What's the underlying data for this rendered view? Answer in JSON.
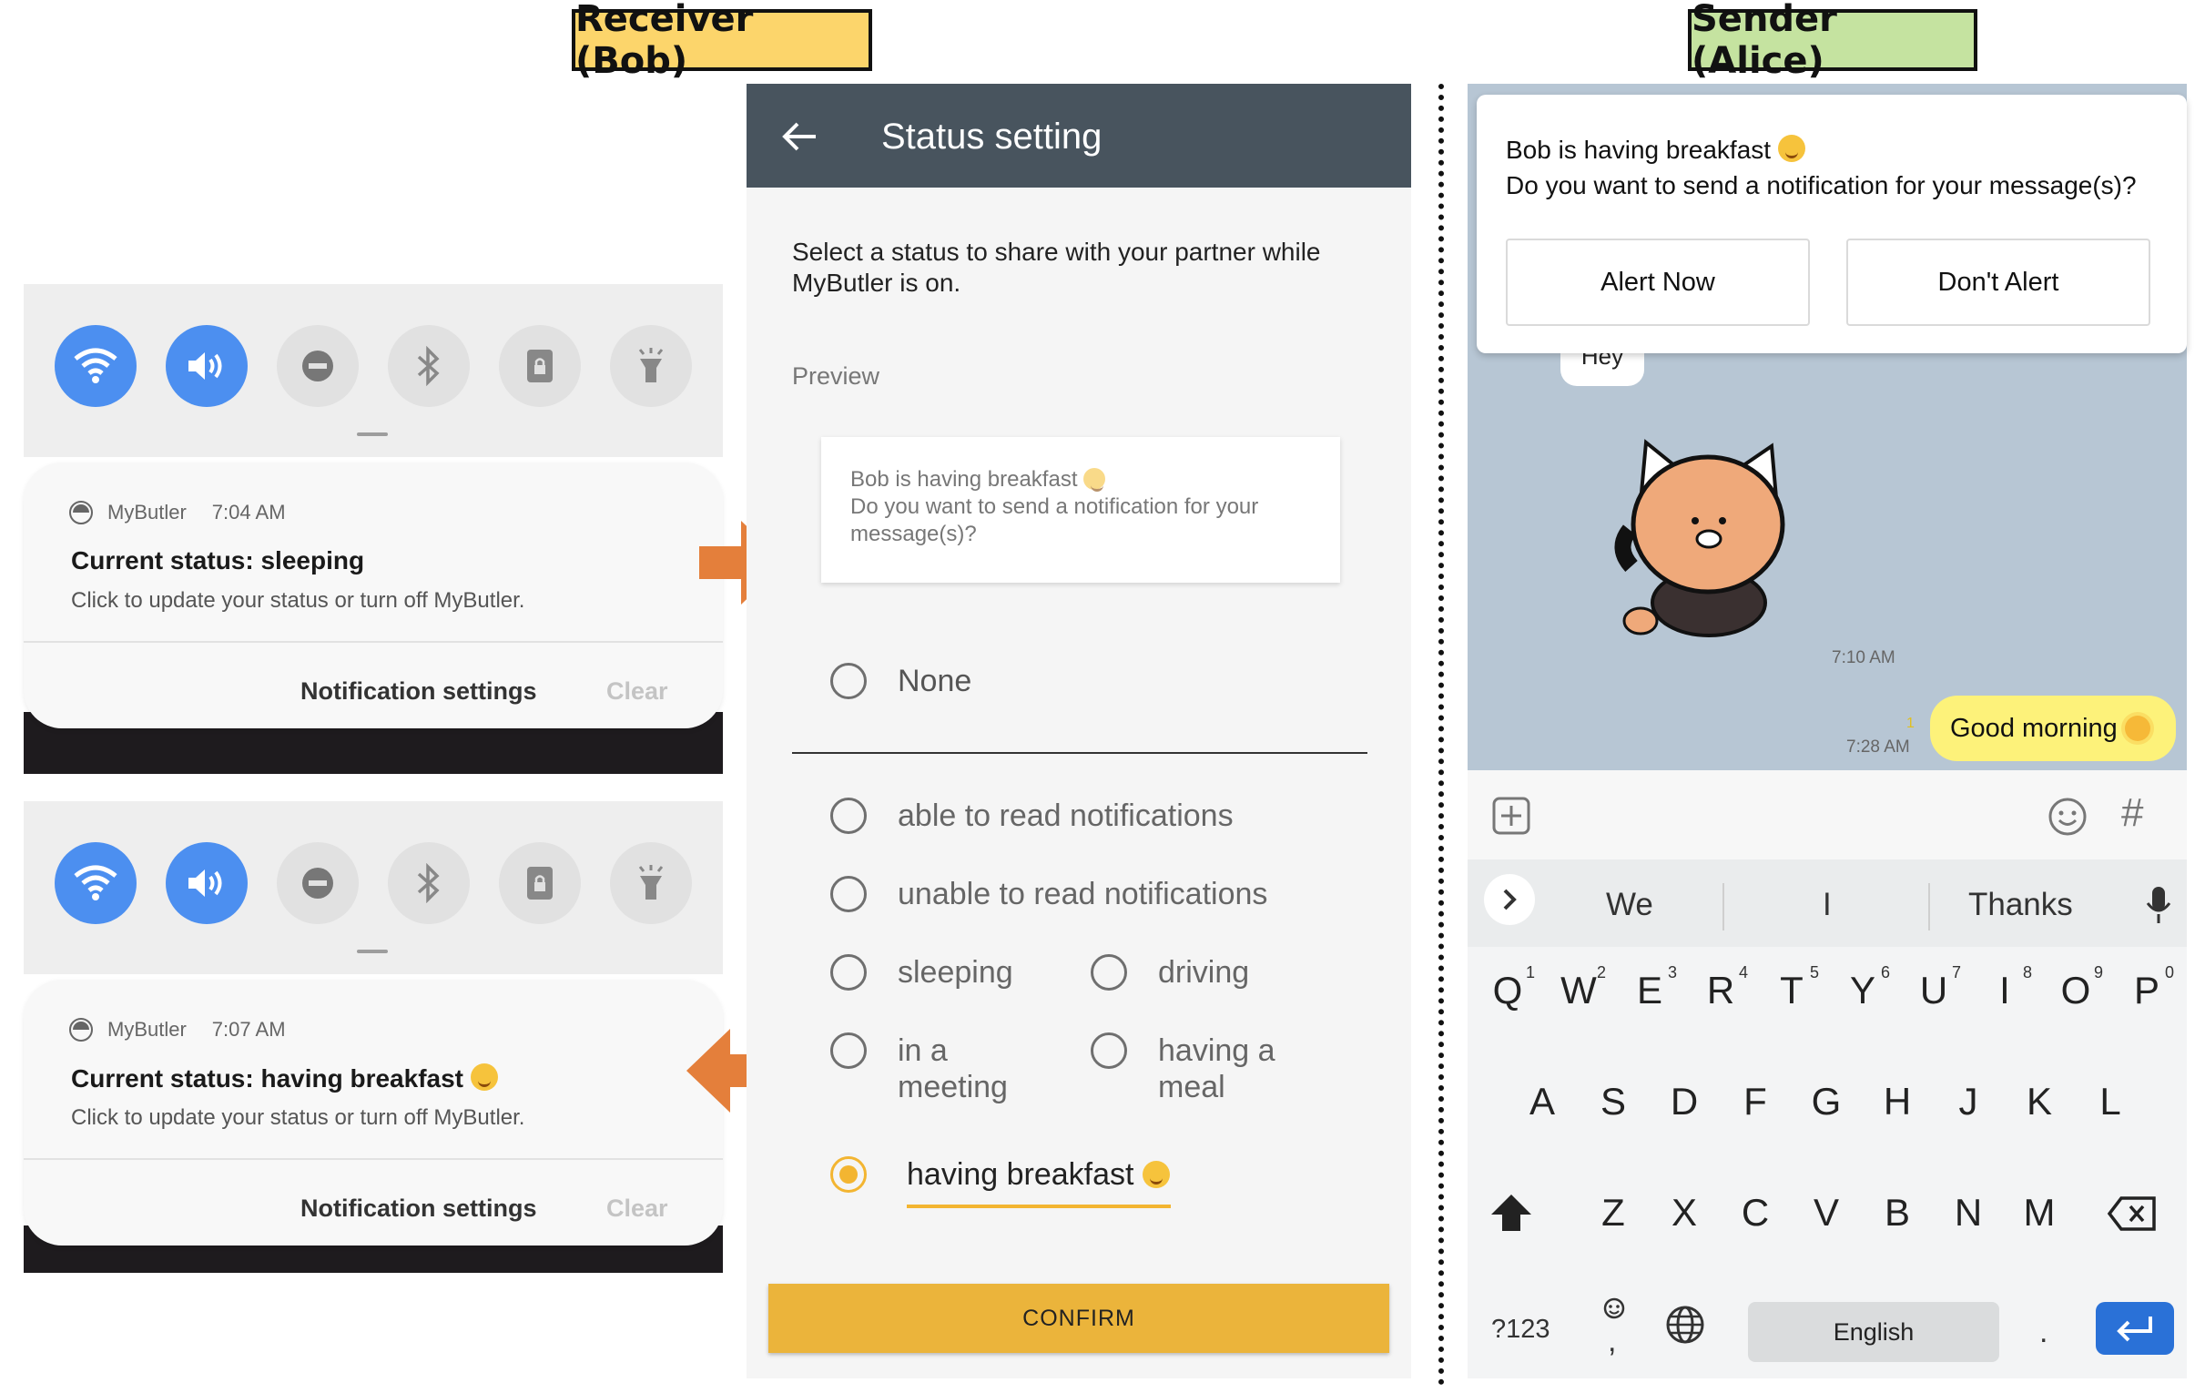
{
  "labels": {
    "receiver": "Receiver (Bob)",
    "sender": "Sender (Alice)"
  },
  "colors": {
    "accent_yellow": "#f3b531",
    "header_gray": "#48545e",
    "toggle_blue": "#4c8ff0",
    "arrow_orange": "#e47f3b",
    "bob_label": "#fcd56b",
    "alice_label": "#c5e3a0"
  },
  "notif1": {
    "app": "MyButler",
    "time": "7:04 AM",
    "title": "Current status: sleeping",
    "body": "Click to update your status or turn off MyButler.",
    "settings": "Notification settings",
    "clear": "Clear"
  },
  "notif2": {
    "app": "MyButler",
    "time": "7:07 AM",
    "title": "Current status: having breakfast",
    "body": "Click to update your status or turn off MyButler.",
    "settings": "Notification settings",
    "clear": "Clear"
  },
  "quick_icons": [
    "wifi-icon",
    "volume-icon",
    "do-not-disturb-icon",
    "bluetooth-icon",
    "rotation-lock-icon",
    "flashlight-icon"
  ],
  "status": {
    "title": "Status setting",
    "description": "Select a status to share with your partner while MyButler is on.",
    "preview_label": "Preview",
    "preview_line1": "Bob is having breakfast",
    "preview_line2": "Do you want to send a notification for your message(s)?",
    "options": {
      "none": "None",
      "able": "able to read notifications",
      "unable": "unable to read notifications",
      "sleeping": "sleeping",
      "driving": "driving",
      "meeting_1": "in a",
      "meeting_2": "meeting",
      "meal_1": "having a",
      "meal_2": "meal",
      "breakfast": "having breakfast"
    },
    "selected": "having breakfast",
    "confirm": "CONFIRM"
  },
  "chat": {
    "alert_line1": "Bob is having breakfast",
    "alert_line2": "Do you want to send a notification for your message(s)?",
    "alert_now": "Alert Now",
    "dont_alert": "Don't Alert",
    "hey": "Hey",
    "time1": "7:10 AM",
    "read_count": "1",
    "time2": "7:28 AM",
    "good_morning": "Good morning",
    "hash": "#"
  },
  "keyboard": {
    "suggestions": [
      "We",
      "I",
      "Thanks"
    ],
    "row1": [
      "Q",
      "W",
      "E",
      "R",
      "T",
      "Y",
      "U",
      "I",
      "O",
      "P"
    ],
    "row1_nums": [
      "1",
      "2",
      "3",
      "4",
      "5",
      "6",
      "7",
      "8",
      "9",
      "0"
    ],
    "row2": [
      "A",
      "S",
      "D",
      "F",
      "G",
      "H",
      "J",
      "K",
      "L"
    ],
    "row3": [
      "Z",
      "X",
      "C",
      "V",
      "B",
      "N",
      "M"
    ],
    "sym_key": "?123",
    "comma": ",",
    "space": "English",
    "period": "."
  }
}
